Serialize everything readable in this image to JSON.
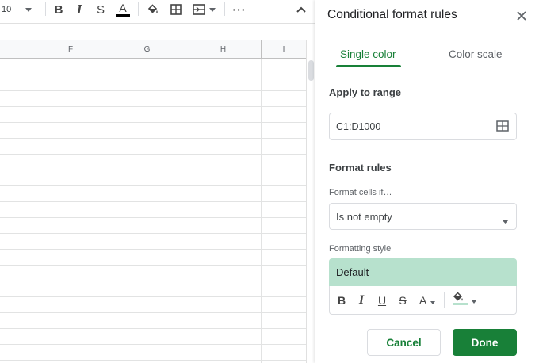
{
  "toolbar": {
    "font_size": "10",
    "bold_label": "B",
    "italic_label": "I",
    "strike_label": "S",
    "text_color_label": "A",
    "text_color": "#000000",
    "more_label": "···",
    "icons": [
      "chevron-down-icon",
      "fill-color-icon",
      "borders-icon",
      "merge-cells-icon",
      "chevron-up-icon"
    ]
  },
  "sheet": {
    "columns": [
      "F",
      "G",
      "H",
      "I"
    ]
  },
  "panel": {
    "title": "Conditional format rules",
    "tabs": [
      {
        "label": "Single color",
        "active": true
      },
      {
        "label": "Color scale",
        "active": false
      }
    ],
    "apply_to_range_label": "Apply to range",
    "range_value": "C1:D1000",
    "format_rules_label": "Format rules",
    "format_cells_if_label": "Format cells if…",
    "condition_value": "Is not empty",
    "formatting_style_label": "Formatting style",
    "style_preview_label": "Default",
    "style_preview_color": "#b7e1cd",
    "style_buttons": {
      "bold": "B",
      "italic": "I",
      "underline": "U",
      "strike": "S",
      "text_color": "A"
    },
    "cancel_label": "Cancel",
    "done_label": "Done",
    "accent_color": "#188038"
  }
}
